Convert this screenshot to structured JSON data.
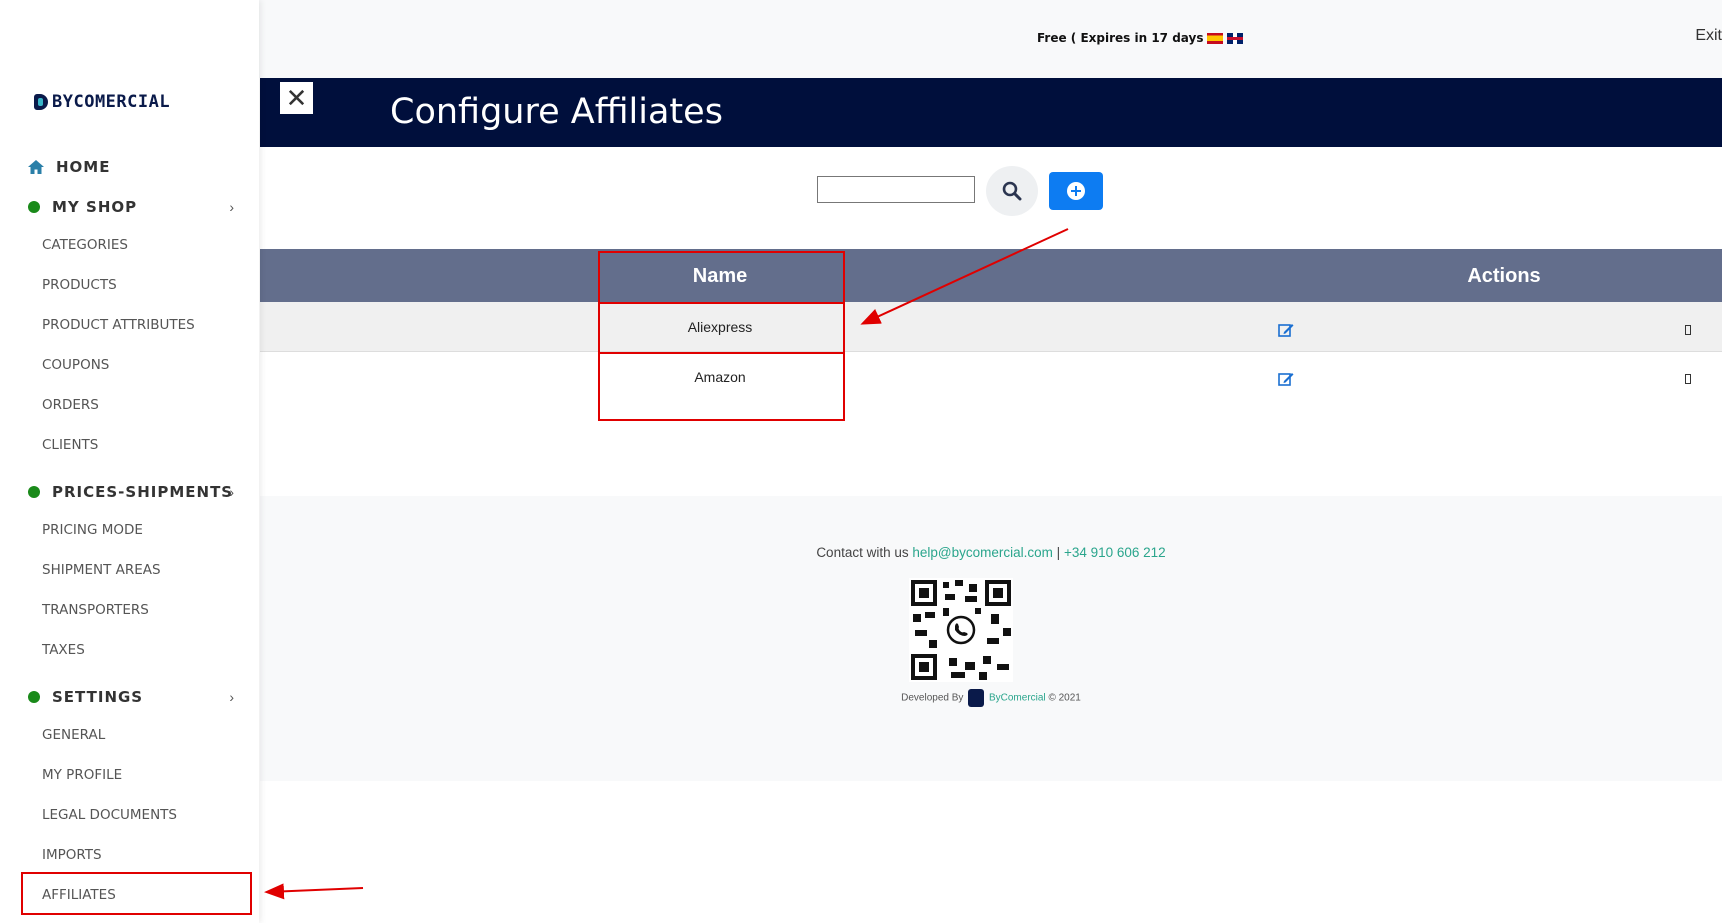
{
  "brand": {
    "logo_text": "BYCOMERCIAL"
  },
  "sidebar": {
    "home": "HOME",
    "my_shop": {
      "label": "MY SHOP",
      "items": [
        "CATEGORIES",
        "PRODUCTS",
        "PRODUCT ATTRIBUTES",
        "COUPONS",
        "ORDERS",
        "CLIENTS"
      ]
    },
    "prices_shipments": {
      "label": "PRICES-SHIPMENTS",
      "items": [
        "PRICING MODE",
        "SHIPMENT AREAS",
        "TRANSPORTERS",
        "TAXES"
      ]
    },
    "settings": {
      "label": "SETTINGS",
      "items": [
        "GENERAL",
        "MY PROFILE",
        "LEGAL DOCUMENTS",
        "IMPORTS",
        "AFFILIATES"
      ]
    }
  },
  "topbar": {
    "plan_text": "Free ( Expires in 17 days",
    "exit_label": "Exit"
  },
  "header": {
    "close_symbol": "✕",
    "title": "Configure Affiliates"
  },
  "search": {
    "value": ""
  },
  "table": {
    "columns": [
      "Name",
      "Actions"
    ],
    "rows": [
      {
        "name": "Aliexpress"
      },
      {
        "name": "Amazon"
      }
    ]
  },
  "footer": {
    "contact_prefix": "Contact with us",
    "email": "help@bycomercial.com",
    "separator": "|",
    "phone": "+34 910 606 212",
    "developed_by": "Developed By",
    "brand": "ByComercial",
    "copyright": "© 2021"
  },
  "colors": {
    "header_bg": "#000f3c",
    "table_header_bg": "#636e8c",
    "primary_button": "#0d7cf2",
    "accent_green": "#2aa58c",
    "annotation_red": "#e00000"
  }
}
